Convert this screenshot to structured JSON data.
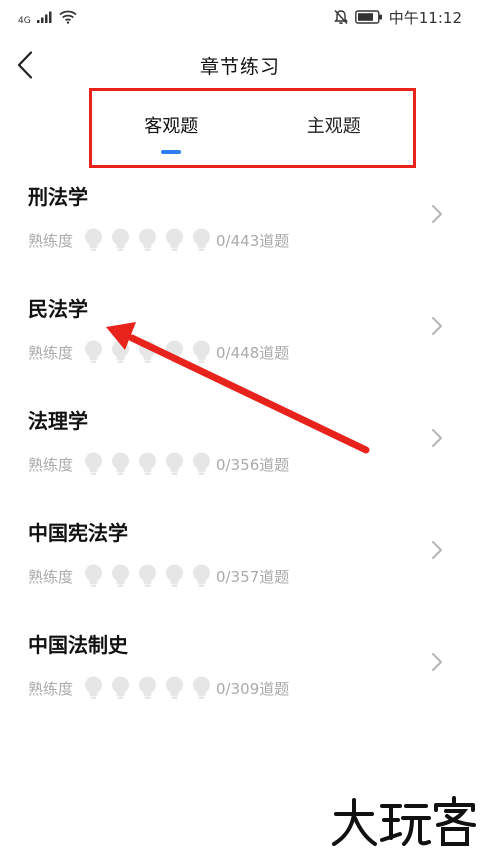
{
  "status_bar": {
    "network_type": "4G",
    "time": "中午11:12",
    "icons": [
      "signal-icon",
      "wifi-icon",
      "mute-icon",
      "battery-icon"
    ]
  },
  "header": {
    "title": "章节练习",
    "back_icon": "chevron-left-icon"
  },
  "tabs": [
    {
      "label": "客观题",
      "active": true
    },
    {
      "label": "主观题",
      "active": false
    }
  ],
  "progress_label": "熟练度",
  "chapters": [
    {
      "title": "刑法学",
      "progress": "0/443道题"
    },
    {
      "title": "民法学",
      "progress": "0/448道题"
    },
    {
      "title": "法理学",
      "progress": "0/356道题"
    },
    {
      "title": "中国宪法学",
      "progress": "0/357道题"
    },
    {
      "title": "中国法制史",
      "progress": "0/309道题"
    }
  ],
  "colors": {
    "accent": "#2d7df6",
    "annotation": "#e8231b",
    "muted_text": "#aaaaaa",
    "bulb": "#e6e6e6"
  },
  "watermark": "大玩客"
}
